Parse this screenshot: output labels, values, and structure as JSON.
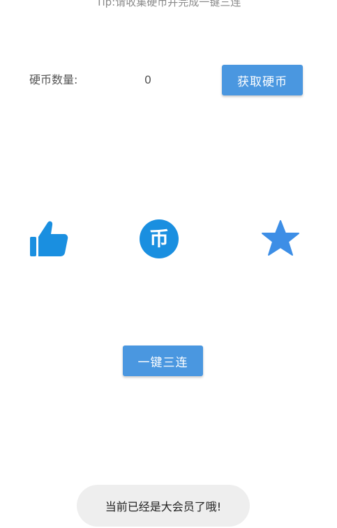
{
  "tip": "Tip:请收集硬币并完成一键三连",
  "coins": {
    "label": "硬币数量:",
    "count": "0",
    "get_button": "获取硬币"
  },
  "actions": {
    "like_icon": "thumbs-up-icon",
    "coin_icon": "coin-icon",
    "coin_glyph": "币",
    "star_icon": "star-icon"
  },
  "triple_button": "一键三连",
  "toast": "当前已经是大会员了哦!",
  "colors": {
    "accent": "#4a97e0",
    "icon_blue": "#1a8fe0",
    "star_blue": "#3d8ee6"
  }
}
